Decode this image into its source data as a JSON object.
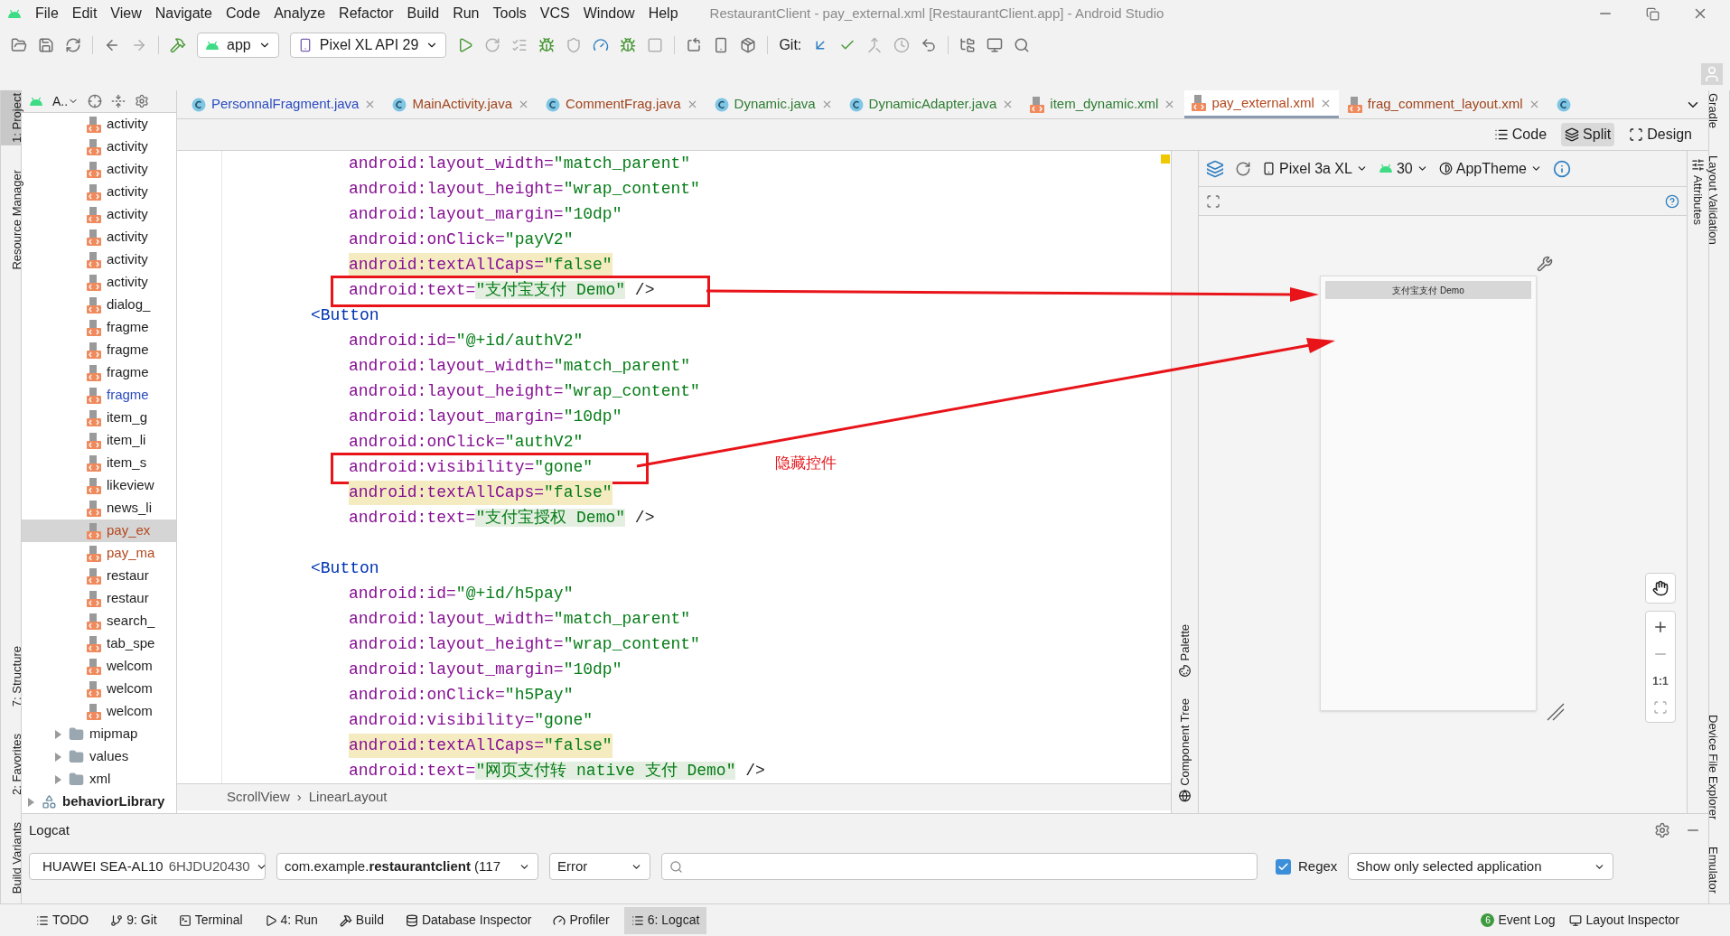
{
  "window": {
    "title": "RestaurantClient - pay_external.xml [RestaurantClient.app] - Android Studio",
    "menu": [
      "File",
      "Edit",
      "View",
      "Navigate",
      "Code",
      "Analyze",
      "Refactor",
      "Build",
      "Run",
      "Tools",
      "VCS",
      "Window",
      "Help"
    ]
  },
  "toolbar": {
    "run_config": "app",
    "device": "Pixel XL API 29",
    "git_label": "Git:"
  },
  "left_strip": [
    {
      "label": "1: Project",
      "selected": true,
      "kind": "top"
    },
    {
      "label": "Resource Manager",
      "selected": false,
      "kind": "top"
    },
    {
      "label": "7: Structure",
      "selected": false,
      "kind": "bottom"
    },
    {
      "label": "2: Favorites",
      "selected": false,
      "kind": "bottom"
    },
    {
      "label": "Build Variants",
      "selected": false,
      "kind": "bottom"
    }
  ],
  "right_strip": [
    {
      "label": "Gradle",
      "kind": "top"
    },
    {
      "label": "Layout Validation",
      "kind": "top"
    },
    {
      "label": "Device File Explorer",
      "kind": "bottom"
    },
    {
      "label": "Emulator",
      "kind": "bottom"
    }
  ],
  "project": {
    "header": "A..",
    "items": [
      {
        "kind": "file",
        "name": "activity",
        "color": "#1f1f1f",
        "selected": false
      },
      {
        "kind": "file",
        "name": "activity",
        "color": "#1f1f1f",
        "selected": false
      },
      {
        "kind": "file",
        "name": "activity",
        "color": "#1f1f1f",
        "selected": false
      },
      {
        "kind": "file",
        "name": "activity",
        "color": "#1f1f1f",
        "selected": false
      },
      {
        "kind": "file",
        "name": "activity",
        "color": "#1f1f1f",
        "selected": false
      },
      {
        "kind": "file",
        "name": "activity",
        "color": "#1f1f1f",
        "selected": false
      },
      {
        "kind": "file",
        "name": "activity",
        "color": "#1f1f1f",
        "selected": false
      },
      {
        "kind": "file",
        "name": "activity",
        "color": "#1f1f1f",
        "selected": false
      },
      {
        "kind": "file",
        "name": "dialog_",
        "color": "#1f1f1f",
        "selected": false
      },
      {
        "kind": "file",
        "name": "fragme",
        "color": "#1f1f1f",
        "selected": false
      },
      {
        "kind": "file",
        "name": "fragme",
        "color": "#1f1f1f",
        "selected": false
      },
      {
        "kind": "file",
        "name": "fragme",
        "color": "#1f1f1f",
        "selected": false
      },
      {
        "kind": "file",
        "name": "fragme",
        "color": "#2a4bc0",
        "selected": false
      },
      {
        "kind": "file",
        "name": "item_g",
        "color": "#1f1f1f",
        "selected": false
      },
      {
        "kind": "file",
        "name": "item_li",
        "color": "#1f1f1f",
        "selected": false
      },
      {
        "kind": "file",
        "name": "item_s",
        "color": "#1f1f1f",
        "selected": false
      },
      {
        "kind": "file",
        "name": "likeview",
        "color": "#1f1f1f",
        "selected": false
      },
      {
        "kind": "file",
        "name": "news_li",
        "color": "#1f1f1f",
        "selected": false
      },
      {
        "kind": "file",
        "name": "pay_ex",
        "color": "#b4481e",
        "selected": true
      },
      {
        "kind": "file",
        "name": "pay_ma",
        "color": "#b4481e",
        "selected": false
      },
      {
        "kind": "file",
        "name": "restaur",
        "color": "#1f1f1f",
        "selected": false
      },
      {
        "kind": "file",
        "name": "restaur",
        "color": "#1f1f1f",
        "selected": false
      },
      {
        "kind": "file",
        "name": "search_",
        "color": "#1f1f1f",
        "selected": false
      },
      {
        "kind": "file",
        "name": "tab_spe",
        "color": "#1f1f1f",
        "selected": false
      },
      {
        "kind": "file",
        "name": "welcom",
        "color": "#1f1f1f",
        "selected": false
      },
      {
        "kind": "file",
        "name": "welcom",
        "color": "#1f1f1f",
        "selected": false
      },
      {
        "kind": "file",
        "name": "welcom",
        "color": "#1f1f1f",
        "selected": false
      },
      {
        "kind": "folder",
        "name": "mipmap",
        "expanded": false,
        "selected": false
      },
      {
        "kind": "folder",
        "name": "values",
        "expanded": false,
        "selected": false
      },
      {
        "kind": "folder",
        "name": "xml",
        "expanded": false,
        "selected": false
      },
      {
        "kind": "module",
        "name": "behaviorLibrary",
        "expanded": false,
        "selected": false
      }
    ]
  },
  "tabs": [
    {
      "label": "PersonnalFragment.java",
      "kind": "java",
      "color": "#2a4bc0",
      "selected": false
    },
    {
      "label": "MainActivity.java",
      "kind": "java",
      "color": "#a0461e",
      "selected": false
    },
    {
      "label": "CommentFrag.java",
      "kind": "java",
      "color": "#a0461e",
      "selected": false
    },
    {
      "label": "Dynamic.java",
      "kind": "java",
      "color": "#2e7d32",
      "selected": false
    },
    {
      "label": "DynamicAdapter.java",
      "kind": "java",
      "color": "#2e7d32",
      "selected": false
    },
    {
      "label": "item_dynamic.xml",
      "kind": "xml",
      "color": "#2e7d32",
      "selected": false
    },
    {
      "label": "pay_external.xml",
      "kind": "xml",
      "color": "#b4481e",
      "selected": true
    },
    {
      "label": "frag_comment_layout.xml",
      "kind": "xml",
      "color": "#a0461e",
      "selected": false
    },
    {
      "kind": "java",
      "selected": false
    }
  ],
  "view_modes": [
    {
      "label": "Code",
      "kind": "code",
      "selected": false
    },
    {
      "label": "Split",
      "kind": "split",
      "selected": true
    },
    {
      "label": "Design",
      "kind": "design",
      "selected": false
    }
  ],
  "code": {
    "lines": [
      {
        "kind": "attr",
        "name": "android:layout_width=",
        "value": "\"match_parent\"",
        "warning": false,
        "value_highlight": false,
        "boxed": false
      },
      {
        "kind": "attr",
        "name": "android:layout_height=",
        "value": "\"wrap_content\"",
        "warning": false,
        "value_highlight": false,
        "boxed": false
      },
      {
        "kind": "attr",
        "name": "android:layout_margin=",
        "value": "\"10dp\"",
        "warning": false,
        "value_highlight": false,
        "boxed": false
      },
      {
        "kind": "attr",
        "name": "android:onClick=",
        "value": "\"payV2\"",
        "warning": false,
        "value_highlight": false,
        "boxed": false
      },
      {
        "kind": "attr",
        "name": "android:textAllCaps=",
        "value": "\"false\"",
        "warning": true,
        "value_highlight": false,
        "boxed": false
      },
      {
        "kind": "attr",
        "name": "android:text=",
        "value": "\"支付宝支付 Demo\"",
        "end": " />",
        "warning": false,
        "value_highlight": true,
        "boxed": true
      },
      {
        "kind": "tag",
        "text": "<Button"
      },
      {
        "kind": "attr",
        "name": "android:id=",
        "value": "\"@+id/authV2\"",
        "warning": false,
        "value_highlight": false,
        "boxed": false
      },
      {
        "kind": "attr",
        "name": "android:layout_width=",
        "value": "\"match_parent\"",
        "warning": false,
        "value_highlight": false,
        "boxed": false
      },
      {
        "kind": "attr",
        "name": "android:layout_height=",
        "value": "\"wrap_content\"",
        "warning": false,
        "value_highlight": false,
        "boxed": false
      },
      {
        "kind": "attr",
        "name": "android:layout_margin=",
        "value": "\"10dp\"",
        "warning": false,
        "value_highlight": false,
        "boxed": false
      },
      {
        "kind": "attr",
        "name": "android:onClick=",
        "value": "\"authV2\"",
        "warning": false,
        "value_highlight": false,
        "boxed": false
      },
      {
        "kind": "attr",
        "name": "android:visibility=",
        "value": "\"gone\"",
        "warning": false,
        "value_highlight": false,
        "boxed": true
      },
      {
        "kind": "attr",
        "name": "android:textAllCaps=",
        "value": "\"false\"",
        "warning": true,
        "value_highlight": false,
        "boxed": false
      },
      {
        "kind": "attr",
        "name": "android:text=",
        "value": "\"支付宝授权 Demo\"",
        "end": " />",
        "warning": false,
        "value_highlight": true,
        "boxed": false
      },
      {
        "kind": "blank"
      },
      {
        "kind": "tag",
        "text": "<Button"
      },
      {
        "kind": "attr",
        "name": "android:id=",
        "value": "\"@+id/h5pay\"",
        "warning": false,
        "value_highlight": false,
        "boxed": false
      },
      {
        "kind": "attr",
        "name": "android:layout_width=",
        "value": "\"match_parent\"",
        "warning": false,
        "value_highlight": false,
        "boxed": false
      },
      {
        "kind": "attr",
        "name": "android:layout_height=",
        "value": "\"wrap_content\"",
        "warning": false,
        "value_highlight": false,
        "boxed": false
      },
      {
        "kind": "attr",
        "name": "android:layout_margin=",
        "value": "\"10dp\"",
        "warning": false,
        "value_highlight": false,
        "boxed": false
      },
      {
        "kind": "attr",
        "name": "android:onClick=",
        "value": "\"h5Pay\"",
        "warning": false,
        "value_highlight": false,
        "boxed": false
      },
      {
        "kind": "attr",
        "name": "android:visibility=",
        "value": "\"gone\"",
        "warning": false,
        "value_highlight": false,
        "boxed": false
      },
      {
        "kind": "attr",
        "name": "android:textAllCaps=",
        "value": "\"false\"",
        "warning": true,
        "value_highlight": false,
        "boxed": false
      },
      {
        "kind": "attr",
        "name": "android:text=",
        "value": "\"网页支付转 native 支付 Demo\"",
        "end": " />",
        "warning": false,
        "value_highlight": true,
        "boxed": false
      }
    ]
  },
  "annotation": {
    "label": "隐藏控件"
  },
  "breadcrumb": {
    "items": [
      "ScrollView",
      "LinearLayout"
    ],
    "separator": "›"
  },
  "design": {
    "device": "Pixel 3a XL",
    "api": "30",
    "theme": "AppTheme",
    "side_tabs": [
      "Palette",
      "Component Tree"
    ],
    "attributes_tab": "Attributes",
    "preview_button": "支付宝支付 Demo",
    "zoom_label": "1:1"
  },
  "logcat": {
    "title": "Logcat",
    "device": "HUAWEI SEA-AL10",
    "device_serial": "6HJDU20430",
    "package": "com.example.**restaurantclient** (117",
    "level": "Error",
    "regex": {
      "label": "Regex",
      "checked": true
    },
    "filter": "Show only selected application"
  },
  "bottom_bar": {
    "left": [
      {
        "label": "TODO",
        "kind": "todo",
        "selected": false
      },
      {
        "label": "9: Git",
        "kind": "git",
        "selected": false
      },
      {
        "label": "Terminal",
        "kind": "terminal",
        "selected": false
      },
      {
        "label": "4: Run",
        "kind": "run",
        "selected": false
      },
      {
        "label": "Build",
        "kind": "build",
        "selected": false
      },
      {
        "label": "Database Inspector",
        "kind": "database",
        "selected": false
      },
      {
        "label": "Profiler",
        "kind": "profiler",
        "selected": false
      },
      {
        "label": "6: Logcat",
        "kind": "logcat",
        "selected": true
      }
    ],
    "right": [
      {
        "label": "Event Log",
        "badge": "6",
        "kind": "events"
      },
      {
        "label": "Layout Inspector",
        "kind": "inspector"
      }
    ]
  }
}
